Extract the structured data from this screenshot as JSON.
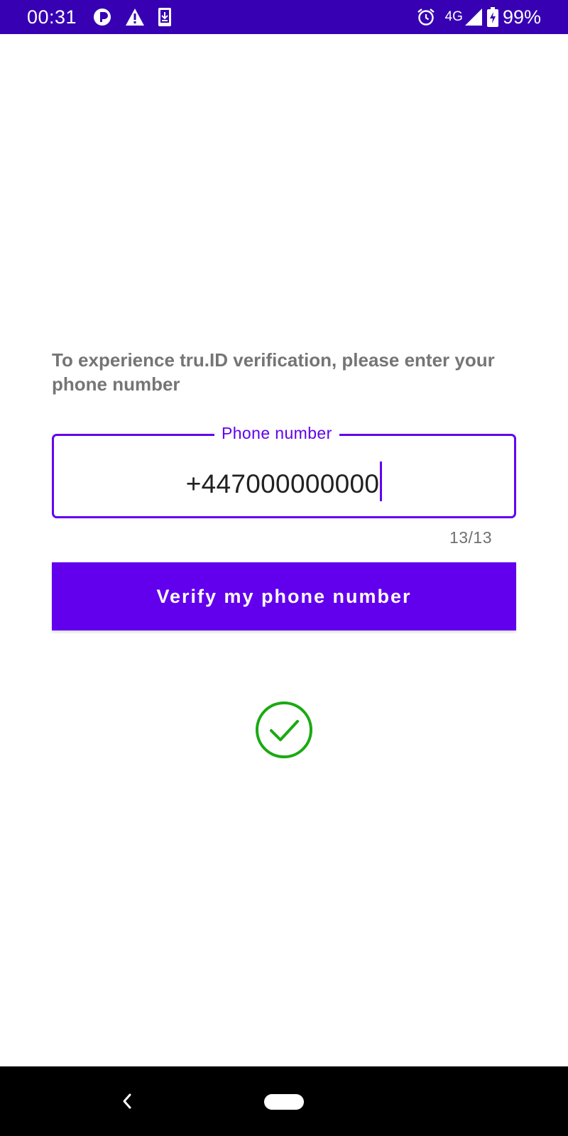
{
  "status_bar": {
    "time": "00:31",
    "left_icons": [
      "data-saver-icon",
      "warning-icon",
      "download-icon"
    ],
    "alarm_icon": "alarm-icon",
    "network": "4G",
    "signal_icon": "signal-icon",
    "battery_icon": "battery-charging-icon",
    "battery": "99%",
    "background_color": "#3700B3"
  },
  "main": {
    "prompt": "To experience tru.ID verification, please enter your phone number",
    "phone_field": {
      "label": "Phone number",
      "value": "+447000000000",
      "counter": "13/13",
      "accent_color": "#6200EE"
    },
    "verify_button": {
      "label": "Verify my phone number",
      "color": "#6200EE"
    },
    "status_icon": "check-circle-icon",
    "status_color": "#1AAA12"
  },
  "nav_bar": {
    "back_icon": "back-chevron-icon",
    "home_icon": "home-pill-icon"
  }
}
